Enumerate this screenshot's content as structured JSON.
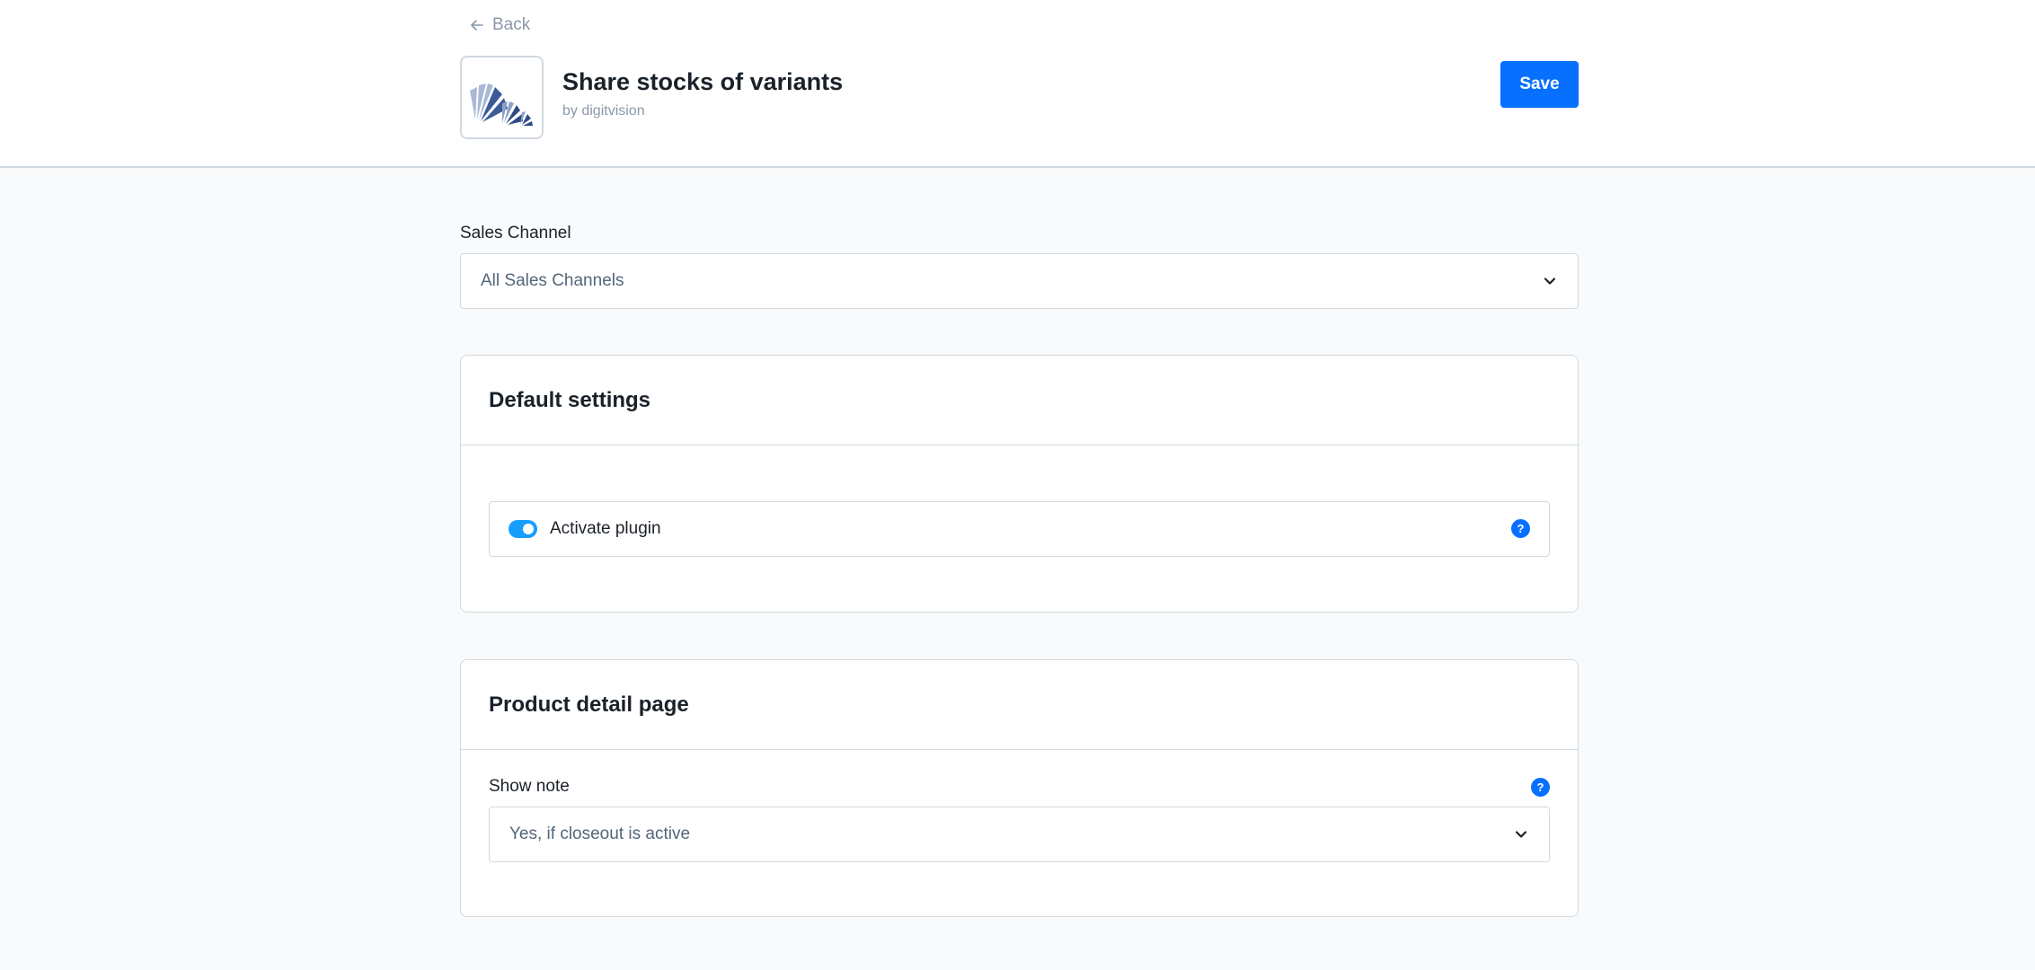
{
  "header": {
    "back_label": "Back",
    "app_title": "Share stocks of variants",
    "app_author": "by digitvision",
    "save_label": "Save"
  },
  "sales_channel": {
    "label": "Sales Channel",
    "selected": "All Sales Channels"
  },
  "default_settings": {
    "title": "Default settings",
    "activate_plugin": {
      "label": "Activate plugin",
      "enabled": true
    }
  },
  "product_detail_page": {
    "title": "Product detail page",
    "show_note": {
      "label": "Show note",
      "selected": "Yes, if closeout is active"
    }
  },
  "colors": {
    "primary": "#0870ff",
    "toggle_on": "#189eff",
    "border": "#d1d9e0",
    "background": "#f9fafb",
    "muted_text": "#8a98a9"
  },
  "icons": {
    "back": "arrow-left-icon",
    "dropdown": "chevron-down-icon",
    "help": "help-icon",
    "app": "app-logo-icon"
  }
}
